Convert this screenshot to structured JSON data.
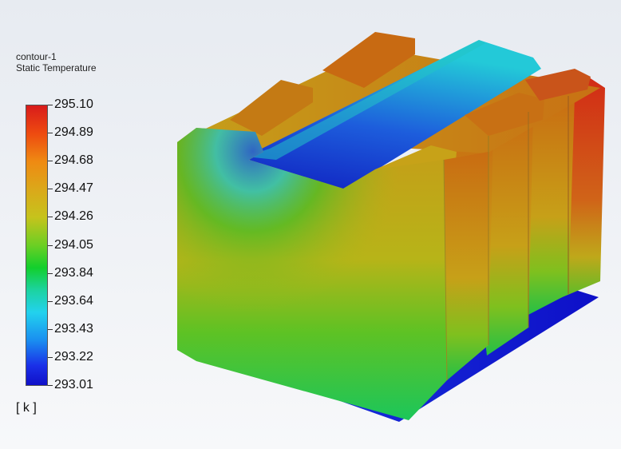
{
  "legend": {
    "title_line1": "contour-1",
    "title_line2": "Static Temperature",
    "ticks": [
      "295.10",
      "294.89",
      "294.68",
      "294.47",
      "294.26",
      "294.05",
      "293.84",
      "293.64",
      "293.43",
      "293.22",
      "293.01"
    ],
    "unit": "[ k ]"
  }
}
